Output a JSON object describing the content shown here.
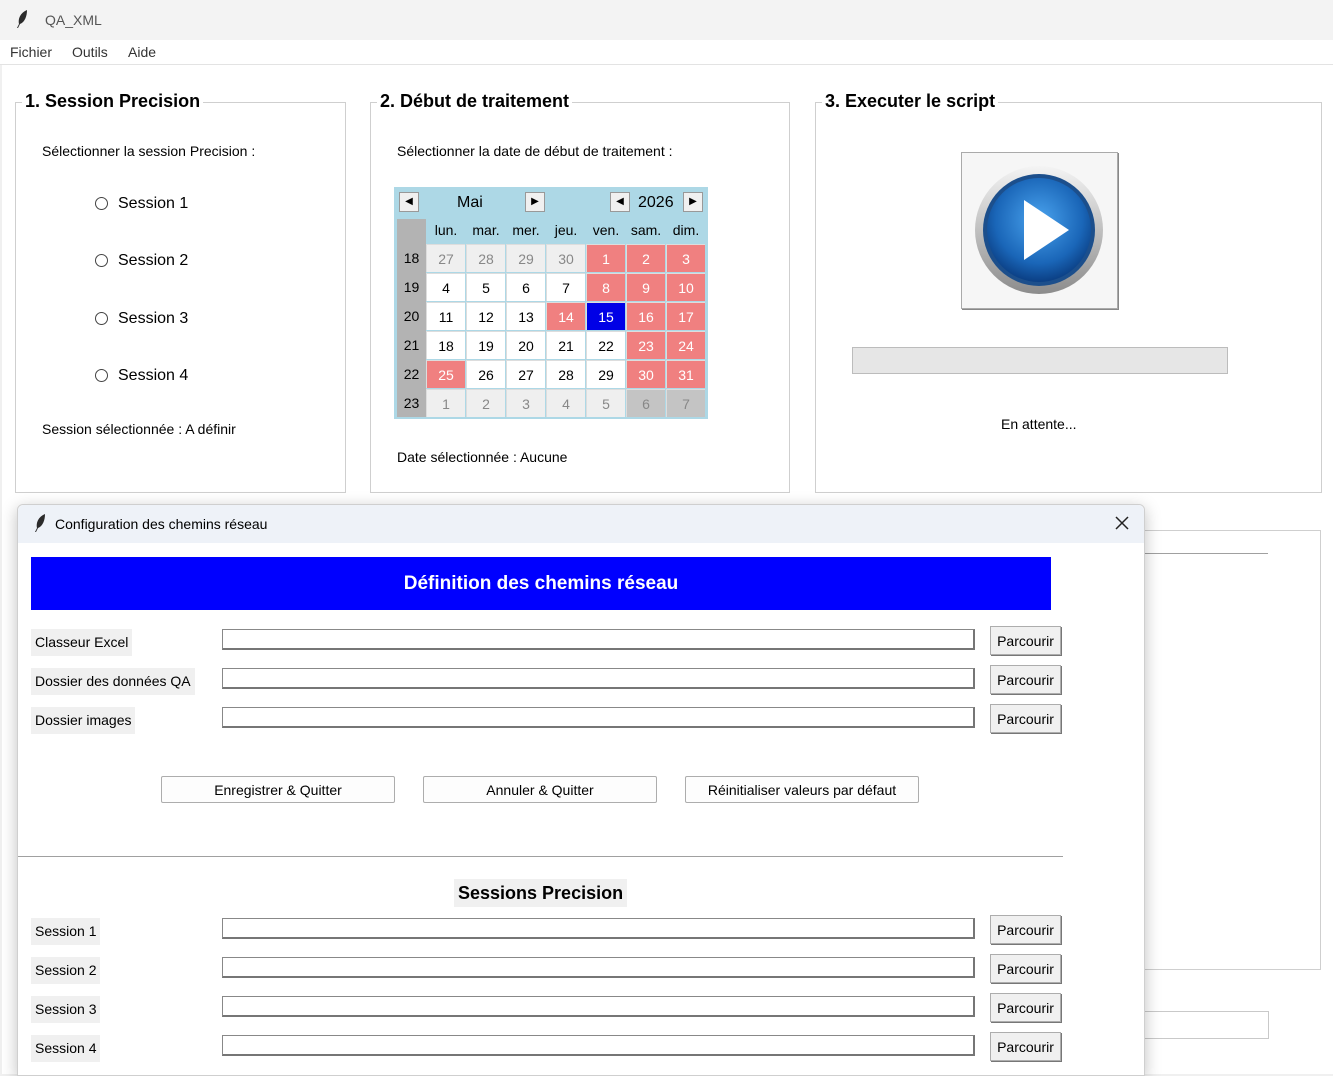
{
  "window": {
    "title": "QA_XML",
    "app_icon": "feather-icon"
  },
  "menu": [
    "Fichier",
    "Outils",
    "Aide"
  ],
  "session_panel": {
    "title": "1. Session Precision",
    "prompt": "Sélectionner la session Precision :",
    "options": [
      "Session 1",
      "Session 2",
      "Session 3",
      "Session 4"
    ],
    "selected_text": "Session sélectionnée : A définir"
  },
  "date_panel": {
    "title": "2. Début de traitement",
    "prompt": "Sélectionner la date de début de traitement :",
    "calendar": {
      "month": "Mai",
      "year": "2026",
      "days_of_week": [
        "lun.",
        "mar.",
        "mer.",
        "jeu.",
        "ven.",
        "sam.",
        "dim."
      ],
      "weeks": [
        {
          "num": "18",
          "days": [
            "27",
            "28",
            "29",
            "30",
            "1",
            "2",
            "3"
          ],
          "kinds": [
            "other",
            "other",
            "other",
            "other",
            "we",
            "we",
            "we"
          ]
        },
        {
          "num": "19",
          "days": [
            "4",
            "5",
            "6",
            "7",
            "8",
            "9",
            "10"
          ],
          "kinds": [
            "",
            "",
            "",
            "",
            "we",
            "we",
            "we"
          ]
        },
        {
          "num": "20",
          "days": [
            "11",
            "12",
            "13",
            "14",
            "15",
            "16",
            "17"
          ],
          "kinds": [
            "",
            "",
            "",
            "we",
            "sel",
            "we",
            "we"
          ]
        },
        {
          "num": "21",
          "days": [
            "18",
            "19",
            "20",
            "21",
            "22",
            "23",
            "24"
          ],
          "kinds": [
            "",
            "",
            "",
            "",
            "",
            "we",
            "we"
          ]
        },
        {
          "num": "22",
          "days": [
            "25",
            "26",
            "27",
            "28",
            "29",
            "30",
            "31"
          ],
          "kinds": [
            "we",
            "",
            "",
            "",
            "",
            "we",
            "we"
          ]
        },
        {
          "num": "23",
          "days": [
            "1",
            "2",
            "3",
            "4",
            "5",
            "6",
            "7"
          ],
          "kinds": [
            "other",
            "other",
            "other",
            "other",
            "other",
            "other-we",
            "other-we"
          ]
        }
      ],
      "weekend_color": "#f08080",
      "selected_color": "#0000e6",
      "header_color": "#add8e6"
    },
    "selected_text": "Date sélectionnée : Aucune"
  },
  "run_panel": {
    "title": "3. Executer le script",
    "play_icon": "play-icon",
    "progress": 0,
    "status": "En attente..."
  },
  "dialog": {
    "title": "Configuration des chemins réseau",
    "banner": "Définition des chemins réseau",
    "paths": [
      {
        "label": "Classeur Excel",
        "value": "",
        "button": "Parcourir"
      },
      {
        "label": "Dossier des données QA",
        "value": "",
        "button": "Parcourir"
      },
      {
        "label": "Dossier images",
        "value": "",
        "button": "Parcourir"
      }
    ],
    "actions": [
      "Enregistrer & Quitter",
      "Annuler & Quitter",
      "Réinitialiser valeurs par défaut"
    ],
    "sessions_title": "Sessions Precision",
    "sessions": [
      {
        "label": "Session 1",
        "value": "",
        "button": "Parcourir"
      },
      {
        "label": "Session 2",
        "value": "",
        "button": "Parcourir"
      },
      {
        "label": "Session 3",
        "value": "",
        "button": "Parcourir"
      },
      {
        "label": "Session 4",
        "value": "",
        "button": "Parcourir"
      }
    ],
    "banner_color": "#0000ff"
  }
}
